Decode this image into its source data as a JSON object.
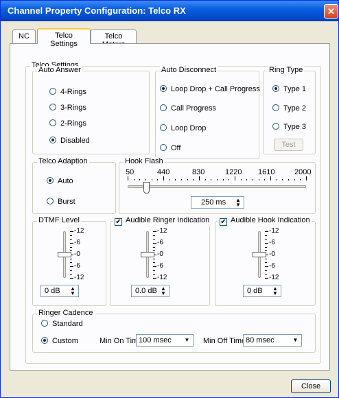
{
  "window": {
    "title": "Channel Property Configuration: Telco RX",
    "close_glyph": "✕"
  },
  "tabs": [
    {
      "label": "NC"
    },
    {
      "label": "Telco Settings"
    },
    {
      "label": "Telco Meters"
    }
  ],
  "telco_settings": {
    "title": "Telco Settings",
    "auto_answer": {
      "title": "Auto Answer",
      "options": [
        "4-Rings",
        "3-Rings",
        "2-Rings",
        "Disabled"
      ],
      "selected": "Disabled"
    },
    "auto_disconnect": {
      "title": "Auto Disconnect",
      "options": [
        "Loop Drop + Call Progress",
        "Call Progress",
        "Loop Drop",
        "Off"
      ],
      "selected": "Loop Drop + Call Progress"
    },
    "ring_type": {
      "title": "Ring Type",
      "options": [
        "Type 1",
        "Type 2",
        "Type 3"
      ],
      "selected": "Type 1",
      "test_label": "Test"
    },
    "telco_adaption": {
      "title": "Telco Adaption",
      "options": [
        "Auto",
        "Burst"
      ],
      "selected": "Auto"
    },
    "hook_flash": {
      "title": "Hook Flash",
      "scale": [
        "50",
        "440",
        "830",
        "1220",
        "1610",
        "2000"
      ],
      "value": "250 ms",
      "slider_value": 250,
      "min": 50,
      "max": 2000
    },
    "dtmf_level": {
      "title": "DTMF Level",
      "scale": [
        "-12",
        "-6",
        "-0",
        "-6",
        "-12"
      ],
      "value": "0 dB",
      "level": 0
    },
    "audible_ringer": {
      "title": "Audible Ringer Indication",
      "checked": true,
      "scale": [
        "-12",
        "-6",
        "-0",
        "-6",
        "-12"
      ],
      "value": "0.0 dB",
      "level": 0
    },
    "audible_hook": {
      "title": "Audible Hook Indication",
      "checked": true,
      "scale": [
        "-12",
        "-6",
        "-0",
        "-6",
        "-12"
      ],
      "value": "0 dB",
      "level": 0
    },
    "ringer_cadence": {
      "title": "Ringer Cadence",
      "options": [
        "Standard",
        "Custom"
      ],
      "selected": "Custom",
      "min_on_label": "Min On Time",
      "min_on_value": "100 msec",
      "min_off_label": "Min Off Time",
      "min_off_value": "80 msec"
    }
  },
  "footer": {
    "close_label": "Close"
  },
  "icons": {
    "spin": "spin-updown-icon",
    "dropdown": "chevron-down-icon",
    "check": "checkmark-icon"
  },
  "colors": {
    "title_bar": "#0a5fe0",
    "tab_highlight": "#ffc83c",
    "dialog_bg": "#ece9d8",
    "panel_bg": "#fcfcfe"
  }
}
